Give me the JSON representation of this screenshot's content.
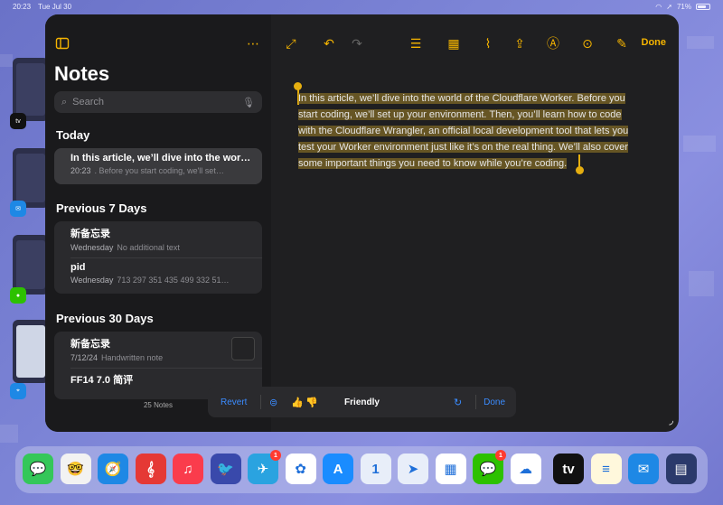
{
  "status": {
    "time": "20:23",
    "date": "Tue Jul 30",
    "battery": "71%",
    "battery_level": 0.71
  },
  "sidebar": {
    "title": "Notes",
    "search_placeholder": "Search",
    "sections": [
      {
        "header": "Today",
        "notes": [
          {
            "title": "In this article, we’ll dive into the wor…",
            "date": "20:23",
            "preview": ". Before you start coding, we'll set…",
            "selected": true
          }
        ]
      },
      {
        "header": "Previous 7 Days",
        "notes": [
          {
            "title": "新备忘录",
            "date": "Wednesday",
            "preview": "No additional text"
          },
          {
            "title": "pid",
            "date": "Wednesday",
            "preview": "713 297 351 435 499 332 51…"
          }
        ]
      },
      {
        "header": "Previous 30 Days",
        "notes": [
          {
            "title": "新备忘录",
            "date": "7/12/24",
            "preview": "Handwritten note",
            "thumbnail": true
          },
          {
            "title": "FF14 7.0 简评",
            "date": "",
            "preview": ""
          }
        ]
      }
    ],
    "count": "25 Notes"
  },
  "toolbar": {
    "done": "Done"
  },
  "editor": {
    "lines": [
      "In this article, we’ll dive into the world of the Cloudflare Worker. Before you",
      "start coding, we’ll set up your environment. Then, you’ll learn how to code",
      "with the Cloudflare Wrangler, an official local development tool that lets you",
      "test your Worker environment just like it’s on the real thing. We’ll also cover",
      "some important things you need to know while you’re coding."
    ]
  },
  "writing_tools": {
    "revert": "Revert",
    "mode": "Friendly",
    "done": "Done"
  },
  "dock": {
    "apps": [
      {
        "name": "messages",
        "color": "#34c759",
        "glyph": "💬"
      },
      {
        "name": "memoji",
        "color": "#f2f2f2",
        "glyph": "🤓"
      },
      {
        "name": "safari",
        "color": "#1e88e5",
        "glyph": "🧭"
      },
      {
        "name": "score",
        "color": "#e53935",
        "glyph": "𝄞"
      },
      {
        "name": "music",
        "color": "#fa3c4c",
        "glyph": "♫"
      },
      {
        "name": "bird-game",
        "color": "#3949ab",
        "glyph": "🐦"
      },
      {
        "name": "telegram",
        "color": "#2aa3e0",
        "glyph": "✈",
        "badge": "1"
      },
      {
        "name": "photos",
        "color": "#ffffff",
        "glyph": "✿"
      },
      {
        "name": "app-store",
        "color": "#1a8cff",
        "glyph": "A"
      },
      {
        "name": "1password",
        "color": "#e8eef9",
        "glyph": "1"
      },
      {
        "name": "spark",
        "color": "#e8eef9",
        "glyph": "➤"
      },
      {
        "name": "calendar-grid",
        "color": "#ffffff",
        "glyph": "▦"
      },
      {
        "name": "wechat",
        "color": "#2dc100",
        "glyph": "💬",
        "badge": "1"
      },
      {
        "name": "weather-cloud",
        "color": "#ffffff",
        "glyph": "☁"
      },
      {
        "name": "apple-tv",
        "color": "#111111",
        "glyph": "tv"
      },
      {
        "name": "notes",
        "color": "#fff8dc",
        "glyph": "≡"
      },
      {
        "name": "mail",
        "color": "#1e88e5",
        "glyph": "✉"
      },
      {
        "name": "folder",
        "color": "#2b3a6b",
        "glyph": "▤"
      }
    ]
  }
}
